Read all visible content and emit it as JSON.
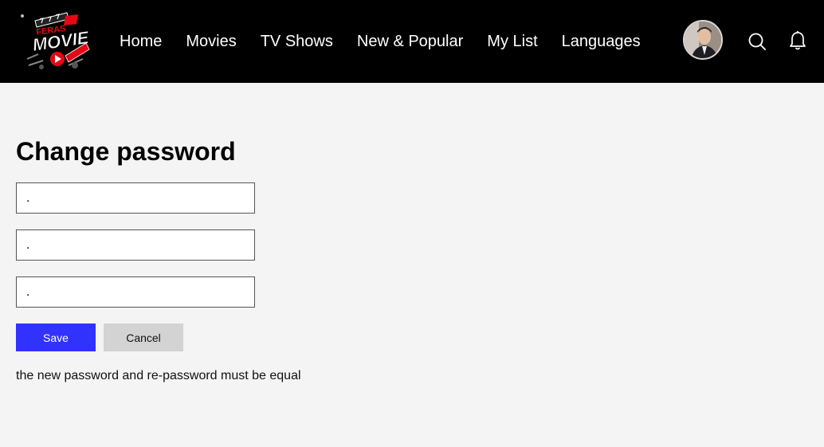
{
  "header": {
    "logo": {
      "text_top": "FERAS",
      "text_main": "MOVIE"
    },
    "nav": [
      {
        "label": "Home"
      },
      {
        "label": "Movies"
      },
      {
        "label": "TV Shows"
      },
      {
        "label": "New & Popular"
      },
      {
        "label": "My List"
      },
      {
        "label": "Languages"
      }
    ]
  },
  "form": {
    "title": "Change password",
    "fields": [
      {
        "value": "."
      },
      {
        "value": "."
      },
      {
        "value": "."
      }
    ],
    "save_label": "Save",
    "cancel_label": "Cancel",
    "message": "the new password and re-password must be equal"
  },
  "colors": {
    "nav_background": "#000000",
    "page_background": "#f4f4f4",
    "save_button": "#3232ff",
    "cancel_button": "#d3d3d3",
    "logo_red": "#e50914"
  },
  "icons": [
    "movie-logo-icon",
    "avatar",
    "search-icon",
    "bell-icon"
  ]
}
